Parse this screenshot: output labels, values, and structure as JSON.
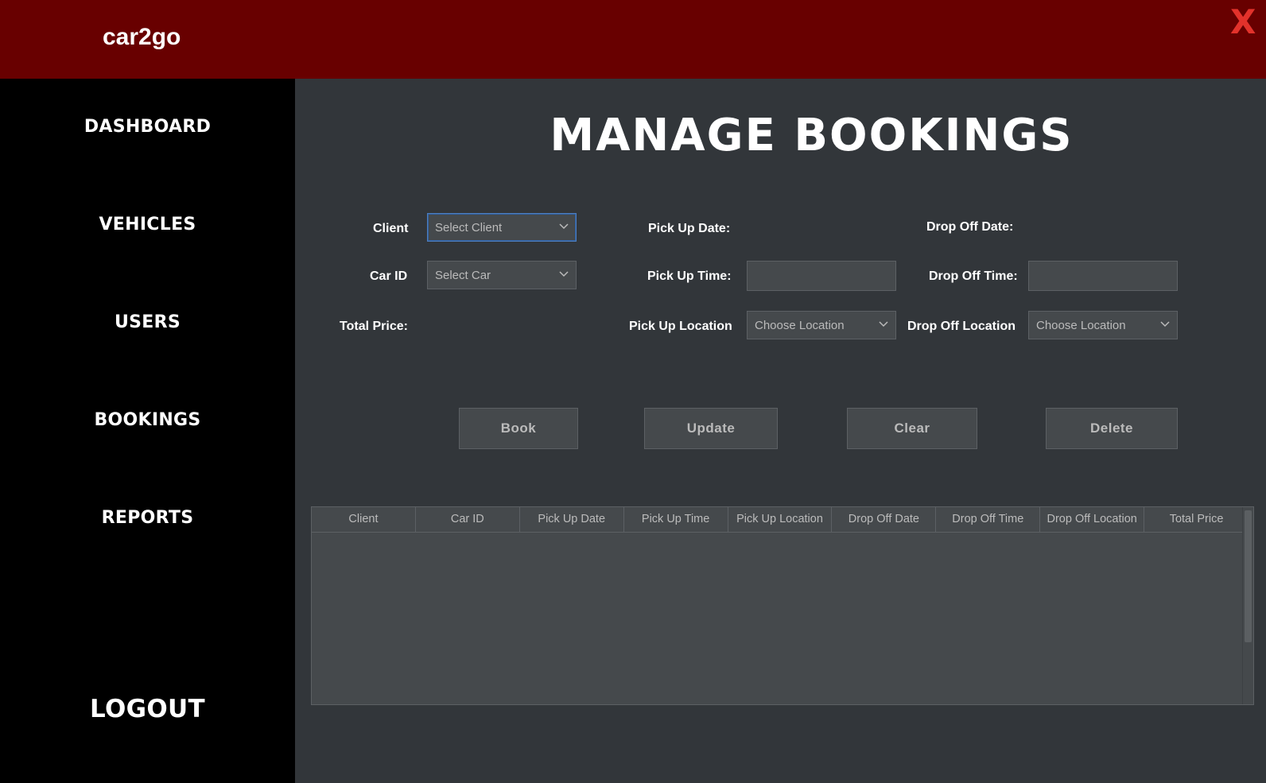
{
  "app": {
    "title": "car2go",
    "close_label": "X"
  },
  "sidebar": {
    "items": [
      {
        "label": "DASHBOARD"
      },
      {
        "label": "VEHICLES"
      },
      {
        "label": "USERS"
      },
      {
        "label": "BOOKINGS"
      },
      {
        "label": "REPORTS"
      }
    ],
    "logout_label": "LOGOUT"
  },
  "page": {
    "title": "MANAGE BOOKINGS"
  },
  "form": {
    "client_label": "Client",
    "client_value": "Select Client",
    "car_label": "Car ID",
    "car_value": "Select Car",
    "total_price_label": "Total Price:",
    "pickup_date_label": "Pick Up Date:",
    "pickup_time_label": "Pick Up Time:",
    "pickup_location_label": "Pick Up Location",
    "pickup_location_value": "Choose Location",
    "dropoff_date_label": "Drop Off Date:",
    "dropoff_time_label": "Drop Off Time:",
    "dropoff_location_label": "Drop Off Location",
    "dropoff_location_value": "Choose Location"
  },
  "buttons": {
    "book": "Book",
    "update": "Update",
    "clear": "Clear",
    "delete": "Delete"
  },
  "table": {
    "columns": [
      "Client",
      "Car ID",
      "Pick Up Date",
      "Pick Up Time",
      "Pick Up Location",
      "Drop Off Date",
      "Drop Off Time",
      "Drop Off Location",
      "Total Price"
    ],
    "rows": []
  },
  "colors": {
    "topbar": "#680000",
    "sidebar": "#000000",
    "content_bg": "#32363a",
    "control_bg": "#45494c",
    "close_icon": "#e3322b"
  },
  "icons": {
    "close": "close-icon",
    "dropdown": "chevron-down-icon"
  }
}
